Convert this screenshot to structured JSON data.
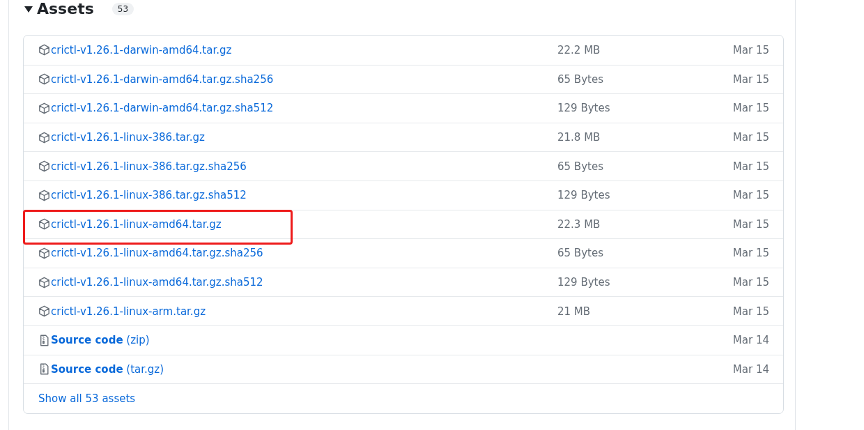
{
  "section": {
    "title": "Assets",
    "expanded": true,
    "count": "53"
  },
  "assets": [
    {
      "kind": "package",
      "name": "crictl-v1.26.1-darwin-amd64.tar.gz",
      "size": "22.2 MB",
      "date": "Mar 15",
      "highlighted": false
    },
    {
      "kind": "package",
      "name": "crictl-v1.26.1-darwin-amd64.tar.gz.sha256",
      "size": "65 Bytes",
      "date": "Mar 15",
      "highlighted": false
    },
    {
      "kind": "package",
      "name": "crictl-v1.26.1-darwin-amd64.tar.gz.sha512",
      "size": "129 Bytes",
      "date": "Mar 15",
      "highlighted": false
    },
    {
      "kind": "package",
      "name": "crictl-v1.26.1-linux-386.tar.gz",
      "size": "21.8 MB",
      "date": "Mar 15",
      "highlighted": false
    },
    {
      "kind": "package",
      "name": "crictl-v1.26.1-linux-386.tar.gz.sha256",
      "size": "65 Bytes",
      "date": "Mar 15",
      "highlighted": false
    },
    {
      "kind": "package",
      "name": "crictl-v1.26.1-linux-386.tar.gz.sha512",
      "size": "129 Bytes",
      "date": "Mar 15",
      "highlighted": false
    },
    {
      "kind": "package",
      "name": "crictl-v1.26.1-linux-amd64.tar.gz",
      "size": "22.3 MB",
      "date": "Mar 15",
      "highlighted": true
    },
    {
      "kind": "package",
      "name": "crictl-v1.26.1-linux-amd64.tar.gz.sha256",
      "size": "65 Bytes",
      "date": "Mar 15",
      "highlighted": false
    },
    {
      "kind": "package",
      "name": "crictl-v1.26.1-linux-amd64.tar.gz.sha512",
      "size": "129 Bytes",
      "date": "Mar 15",
      "highlighted": false
    },
    {
      "kind": "package",
      "name": "crictl-v1.26.1-linux-arm.tar.gz",
      "size": "21 MB",
      "date": "Mar 15",
      "highlighted": false
    },
    {
      "kind": "archive",
      "name": "**Source code** (zip)",
      "date": "Mar 14",
      "highlighted": false
    },
    {
      "kind": "archive",
      "name": "**Source code** (tar.gz)",
      "date": "Mar 14",
      "highlighted": false
    }
  ],
  "show_all_link": "Show all 53 assets"
}
